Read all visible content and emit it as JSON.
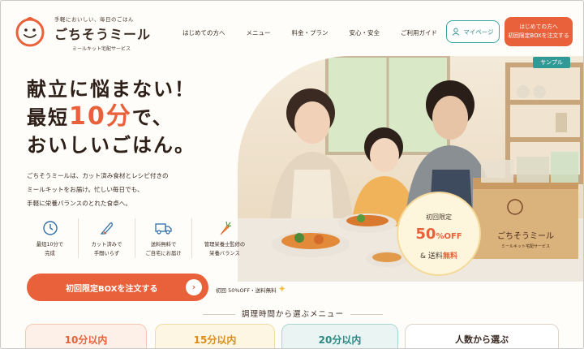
{
  "brand": {
    "tagline": "手軽においしい、毎日のごはん",
    "name": "ごちそうミール",
    "subtitle": "ミールキット宅配サービス"
  },
  "nav": {
    "items": [
      {
        "label": "はじめての方へ"
      },
      {
        "label": "メニュー"
      },
      {
        "label": "料金・プラン"
      },
      {
        "label": "安心・安全"
      },
      {
        "label": "ご利用ガイド"
      }
    ],
    "mypage_label": "マイページ",
    "cta_line1": "はじめての方へ",
    "cta_line2": "初回限定BOXを注文する"
  },
  "hero": {
    "headline_line1": "献立に悩まない！",
    "headline_pre": "最短",
    "headline_num": "10分",
    "headline_post": "で、",
    "headline_line3": "おいしいごはん。",
    "description_line1": "ごちそうミールは、カット済み食材とレシピ付きの",
    "description_line2": "ミールキットをお届け。忙しい毎日でも、",
    "description_line3": "手軽に栄養バランスのとれた食卓へ。",
    "sample_tag": "サンプル",
    "box_label": "ごちそうミール",
    "box_sub": "ミールキット宅配サービス"
  },
  "badge": {
    "line1": "初回限定",
    "percent": "50",
    "off": "%OFF",
    "amp": "& 送料",
    "free": "無料"
  },
  "features": [
    {
      "icon": "clock-icon",
      "line1": "最短10分で",
      "line2": "完成"
    },
    {
      "icon": "knife-icon",
      "line1": "カット済みで",
      "line2": "手間いらず"
    },
    {
      "icon": "truck-icon",
      "line1": "送料無料で",
      "line2": "ご自宅にお届け"
    },
    {
      "icon": "carrot-icon",
      "line1": "管理栄養士監修の",
      "line2": "栄養バランス"
    }
  ],
  "cta": {
    "main_label": "初回限定BOXを注文する",
    "note": "初回 50%OFF・送料無料"
  },
  "menu_section": {
    "title": "調理時間から選ぶメニュー",
    "tiles": [
      {
        "label": "10分以内"
      },
      {
        "label": "15分以内"
      },
      {
        "label": "20分以内"
      },
      {
        "label": "人数から選ぶ"
      }
    ]
  },
  "colors": {
    "accent": "#e8613a",
    "teal": "#2f9a96",
    "text": "#3a2a22",
    "background": "#fffdf9"
  }
}
